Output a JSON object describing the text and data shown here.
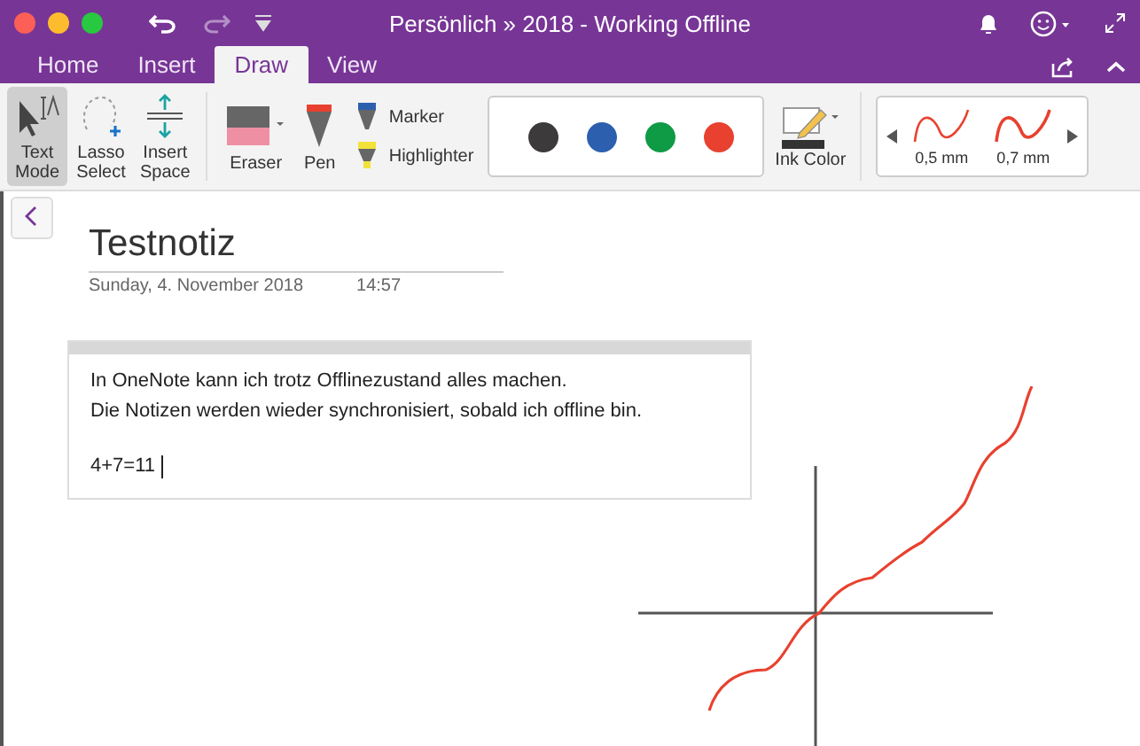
{
  "window": {
    "title": "Persönlich » 2018 - Working Offline"
  },
  "tabs": [
    {
      "label": "Home",
      "selected": false
    },
    {
      "label": "Insert",
      "selected": false
    },
    {
      "label": "Draw",
      "selected": true
    },
    {
      "label": "View",
      "selected": false
    }
  ],
  "tools": [
    {
      "kind": "text-mode",
      "label": "Text\nMode",
      "selected": true
    },
    {
      "kind": "lasso",
      "label": "Lasso\nSelect",
      "selected": false
    },
    {
      "kind": "insert-space",
      "label": "Insert\nSpace",
      "selected": false
    },
    {
      "kind": "eraser",
      "label": "Eraser",
      "selected": false
    },
    {
      "kind": "pen",
      "label": "Pen",
      "selected": false
    }
  ],
  "pens": [
    {
      "kind": "marker",
      "label": "Marker"
    },
    {
      "kind": "highlighter",
      "label": "Highlighter"
    }
  ],
  "colors": [
    {
      "color": "#3d3a3b"
    },
    {
      "color": "#2c5fae"
    },
    {
      "color": "#0f9a45"
    },
    {
      "color": "#e8412f"
    }
  ],
  "ink_color": {
    "label": "Ink Color"
  },
  "thicknesses": [
    {
      "label": "0,5 mm"
    },
    {
      "label": "0,7 mm"
    }
  ],
  "page": {
    "title": "Testnotiz",
    "date": "Sunday, 4. November 2018",
    "time": "14:57",
    "note_lines": [
      "In OneNote kann ich trotz Offlinezustand alles machen.",
      "Die Notizen werden wieder synchronisiert, sobald ich offline bin."
    ],
    "input_line": "4+7=11"
  }
}
